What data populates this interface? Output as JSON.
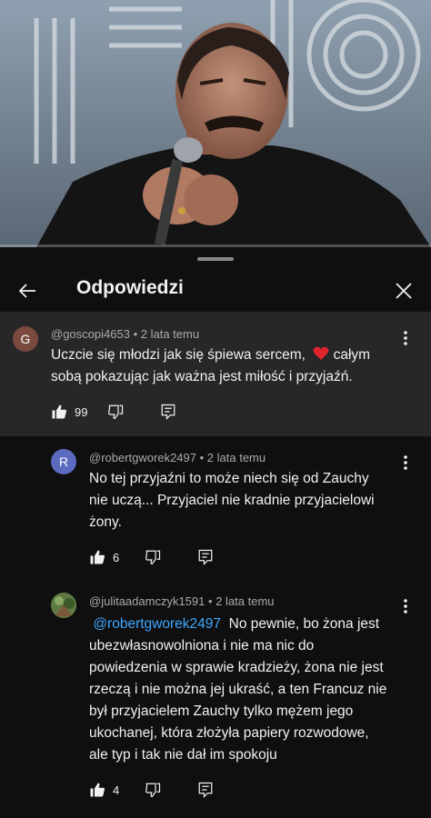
{
  "header": {
    "title": "Odpowiedzi"
  },
  "parent_comment": {
    "avatar_letter": "G",
    "avatar_color": "#7b4a3f",
    "author": "@goscopi4653",
    "time": "2 lata temu",
    "text_line1": "Uczcie się młodzi jak się śpiewa sercem,",
    "text_line1_end": " całym",
    "text_line2": "sobą pokazując jak ważna jest miłość i przyjaźń.",
    "emoji": "heart",
    "likes": "99"
  },
  "replies": [
    {
      "avatar_letter": "R",
      "avatar_color": "#5c6bc0",
      "author": "@robertgworek2497",
      "time": "2 lata temu",
      "lines": [
        "No tej przyjaźni to może niech się od Zauchy",
        "nie uczą... Przyjaciel nie kradnie przyjacielowi",
        "żony."
      ],
      "likes": "6"
    },
    {
      "avatar_letter": "",
      "avatar_color": "#4a6b3a",
      "author": "@julitaadamczyk1591",
      "time": "2 lata temu",
      "mention": "@robertgworek2497",
      "first_line_rest": "No pewnie, bo żona jest",
      "lines": [
        "ubezwłasnowolniona i nie ma nic do",
        "powiedzenia w sprawie kradzieży, żona nie jest",
        "rzeczą i nie można jej ukraść, a ten Francuz nie",
        "był przyjacielem Zauchy tylko mężem jego",
        "ukochanej, która złożyła papiery rozwodowe,",
        "ale typ i tak nie dał im spokoju"
      ],
      "likes": "4"
    }
  ],
  "separator": "•",
  "icons": [
    "back-arrow-icon",
    "close-icon",
    "like-icon",
    "dislike-icon",
    "reply-icon",
    "more-vert-icon"
  ]
}
